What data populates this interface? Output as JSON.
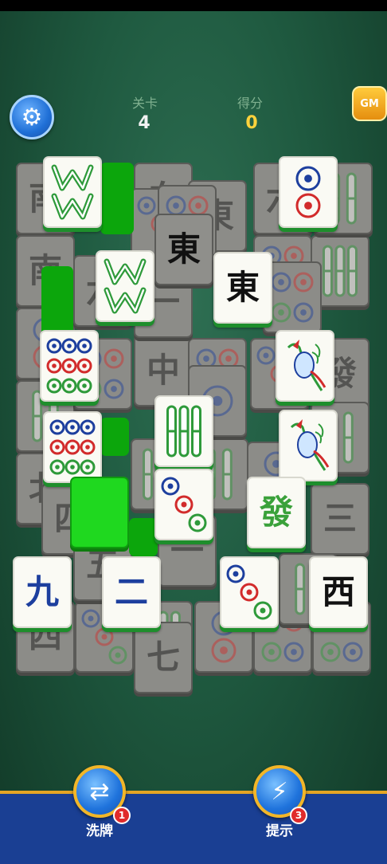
{
  "header": {
    "level_label": "关卡",
    "level_value": "4",
    "score_label": "得分",
    "score_value": "0",
    "gm_label": "GM",
    "settings_icon": "gear-icon"
  },
  "colors": {
    "table_green": "#1f5a40",
    "tile_face": "#fafaf4",
    "tile_dim": "#8c8c88",
    "selected_green": "#1fd81f",
    "bottom_bar": "#1a3f93",
    "accent_gold": "#f2b628",
    "score_yellow": "#ffd23c"
  },
  "tiles": [
    {
      "id": "d1",
      "state": "dim",
      "kind": "char",
      "text": "南"
    },
    {
      "id": "d2",
      "state": "dim",
      "kind": "char",
      "text": "南"
    },
    {
      "id": "d3",
      "state": "dim",
      "kind": "dots",
      "count": 2
    },
    {
      "id": "d4",
      "state": "dim",
      "kind": "bamboo",
      "count": 2
    },
    {
      "id": "d5",
      "state": "dim",
      "kind": "char",
      "text": "北"
    },
    {
      "id": "d6",
      "state": "dim",
      "kind": "char",
      "text": "四"
    },
    {
      "id": "d7",
      "state": "dim",
      "kind": "char",
      "text": "四"
    },
    {
      "id": "d8",
      "state": "dim",
      "kind": "dots",
      "count": 3
    },
    {
      "id": "d9",
      "state": "dim",
      "kind": "char",
      "text": "五"
    },
    {
      "id": "d10",
      "state": "dim",
      "kind": "char",
      "text": "中"
    },
    {
      "id": "d11",
      "state": "dim",
      "kind": "bamboo",
      "count": 3
    },
    {
      "id": "d12",
      "state": "dim",
      "kind": "char",
      "text": "六"
    },
    {
      "id": "d13",
      "state": "dim",
      "kind": "char",
      "text": "六"
    },
    {
      "id": "d14",
      "state": "dim",
      "kind": "char",
      "text": "白"
    },
    {
      "id": "d15",
      "state": "dim",
      "kind": "dots",
      "count": 3
    },
    {
      "id": "d16",
      "state": "dim",
      "kind": "bamboo",
      "count": 3
    },
    {
      "id": "d17",
      "state": "dim",
      "kind": "dots",
      "count": 4
    },
    {
      "id": "d18",
      "state": "dim",
      "kind": "dots",
      "count": 4
    },
    {
      "id": "d19",
      "state": "dim",
      "kind": "char",
      "text": "發"
    },
    {
      "id": "d20",
      "state": "dim",
      "kind": "bamboo",
      "count": 3
    },
    {
      "id": "d21",
      "state": "dim",
      "kind": "dots",
      "count": 3
    },
    {
      "id": "d22",
      "state": "dim",
      "kind": "bamboo",
      "count": 2
    },
    {
      "id": "d23",
      "state": "dim",
      "kind": "char",
      "text": "三"
    },
    {
      "id": "d24",
      "state": "dim",
      "kind": "dots",
      "count": 4
    },
    {
      "id": "d25",
      "state": "dim",
      "kind": "dots",
      "count": 4
    },
    {
      "id": "d26",
      "state": "dim",
      "kind": "dots",
      "count": 2
    },
    {
      "id": "d27",
      "state": "dim",
      "kind": "char",
      "text": "七"
    },
    {
      "id": "d28",
      "state": "dim",
      "kind": "bamboo",
      "count": 2
    },
    {
      "id": "d29",
      "state": "dim",
      "kind": "dots",
      "count": 4
    },
    {
      "id": "d30",
      "state": "dim",
      "kind": "dots",
      "count": 4
    },
    {
      "id": "d31",
      "state": "dim",
      "kind": "char",
      "text": "一"
    },
    {
      "id": "d32",
      "state": "dim",
      "kind": "char",
      "text": "東"
    },
    {
      "id": "d33",
      "state": "dim",
      "kind": "dots",
      "count": 4
    },
    {
      "id": "d34",
      "state": "dim",
      "kind": "bamboo",
      "count": 2
    },
    {
      "id": "d35",
      "state": "dim",
      "kind": "dots",
      "count": 2
    },
    {
      "id": "d36",
      "state": "dim",
      "kind": "char",
      "text": "一"
    },
    {
      "id": "d37",
      "state": "dim",
      "kind": "bamboo",
      "count": 2
    },
    {
      "id": "d38",
      "state": "dim",
      "kind": "dots",
      "count": 1
    },
    {
      "id": "h1",
      "state": "highlight",
      "kind": "blank"
    },
    {
      "id": "h2",
      "state": "highlight",
      "kind": "blank"
    },
    {
      "id": "h3",
      "state": "highlight",
      "kind": "blank"
    },
    {
      "id": "h4",
      "state": "highlight",
      "kind": "blank"
    },
    {
      "id": "l1",
      "state": "lit",
      "kind": "bamboo-w"
    },
    {
      "id": "l2",
      "state": "lit",
      "kind": "dots",
      "count": 2
    },
    {
      "id": "l3",
      "state": "lit",
      "kind": "bamboo-w"
    },
    {
      "id": "l4",
      "state": "lit",
      "kind": "char",
      "text": "東"
    },
    {
      "id": "l5",
      "state": "lit",
      "kind": "dots",
      "count": 9
    },
    {
      "id": "l6",
      "state": "lit",
      "kind": "bird"
    },
    {
      "id": "l7",
      "state": "lit",
      "kind": "dots",
      "count": 9
    },
    {
      "id": "l8",
      "state": "lit",
      "kind": "bamboo",
      "count": 3
    },
    {
      "id": "l9",
      "state": "lit",
      "kind": "bird"
    },
    {
      "id": "l10",
      "state": "selected",
      "kind": "blank"
    },
    {
      "id": "l11",
      "state": "lit",
      "kind": "dots",
      "count": 3
    },
    {
      "id": "l12",
      "state": "lit",
      "kind": "char",
      "text": "發",
      "color": "#3aa13a"
    },
    {
      "id": "l13",
      "state": "lit",
      "kind": "char",
      "text": "九",
      "color": "#1d3f9e"
    },
    {
      "id": "l14",
      "state": "lit",
      "kind": "char",
      "text": "二",
      "color": "#1d3f9e"
    },
    {
      "id": "l15",
      "state": "lit",
      "kind": "dots",
      "count": 3
    },
    {
      "id": "l16",
      "state": "lit",
      "kind": "char",
      "text": "西"
    }
  ],
  "actions": {
    "shuffle_label": "洗牌",
    "shuffle_count": "1",
    "shuffle_icon": "shuffle-arrows-icon",
    "hint_label": "提示",
    "hint_count": "3",
    "hint_icon": "lightning-icon"
  }
}
